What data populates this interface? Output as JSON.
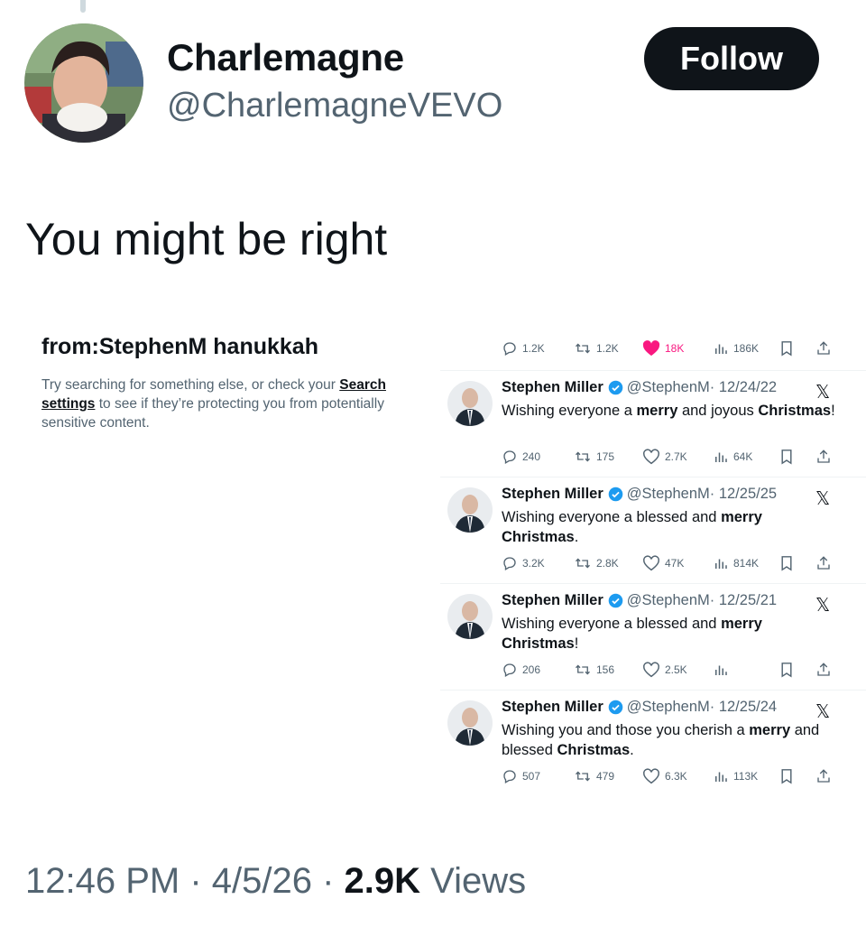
{
  "author": {
    "name": "Charlemagne",
    "handle": "@CharlemagneVEVO",
    "follow_label": "Follow"
  },
  "tweet": {
    "text": "You might be right"
  },
  "embedded_screenshot": {
    "search_query": "from:StephenM hanukkah",
    "search_message": {
      "before": "Try searching for something else, or check your",
      "link": "Search settings",
      "after": "to see if they’re protecting you from potentially sensitive content."
    },
    "top_actions": {
      "replies": "1.2K",
      "reposts": "1.2K",
      "likes": "18K",
      "views": "186K"
    },
    "results": [
      {
        "name": "Stephen Miller",
        "handle": "@StephenM",
        "date": "· 12/24/22",
        "text_parts": [
          {
            "t": "Wishing everyone a ",
            "b": false
          },
          {
            "t": "merry",
            "b": true
          },
          {
            "t": " and joyous ",
            "b": false
          },
          {
            "t": "Christmas",
            "b": true
          },
          {
            "t": "!",
            "b": false
          }
        ],
        "replies": "240",
        "reposts": "175",
        "likes": "2.7K",
        "views": "64K"
      },
      {
        "name": "Stephen Miller",
        "handle": "@StephenM",
        "date": "· 12/25/25",
        "text_parts": [
          {
            "t": "Wishing everyone a blessed and ",
            "b": false
          },
          {
            "t": "merry Christmas",
            "b": true
          },
          {
            "t": ".",
            "b": false
          }
        ],
        "replies": "3.2K",
        "reposts": "2.8K",
        "likes": "47K",
        "views": "814K"
      },
      {
        "name": "Stephen Miller",
        "handle": "@StephenM",
        "date": "· 12/25/21",
        "text_parts": [
          {
            "t": "Wishing everyone a blessed and ",
            "b": false
          },
          {
            "t": "merry Christmas",
            "b": true
          },
          {
            "t": "!",
            "b": false
          }
        ],
        "replies": "206",
        "reposts": "156",
        "likes": "2.5K",
        "views": ""
      },
      {
        "name": "Stephen Miller",
        "handle": "@StephenM",
        "date": "· 12/25/24",
        "text_parts": [
          {
            "t": "Wishing you and those you cherish a ",
            "b": false
          },
          {
            "t": "merry",
            "b": true
          },
          {
            "t": " and blessed ",
            "b": false
          },
          {
            "t": "Christmas",
            "b": true
          },
          {
            "t": ".",
            "b": false
          }
        ],
        "replies": "507",
        "reposts": "479",
        "likes": "6.3K",
        "views": "113K"
      }
    ]
  },
  "footer": {
    "time": "12:46 PM",
    "separator": " · ",
    "date": "4/5/26",
    "views_count": "2.9K",
    "views_label": " Views"
  },
  "colors": {
    "text": "#0f1419",
    "secondary": "#536471",
    "like_pink": "#f91880",
    "verified_blue": "#1d9bf0",
    "divider": "#eff3f4"
  }
}
